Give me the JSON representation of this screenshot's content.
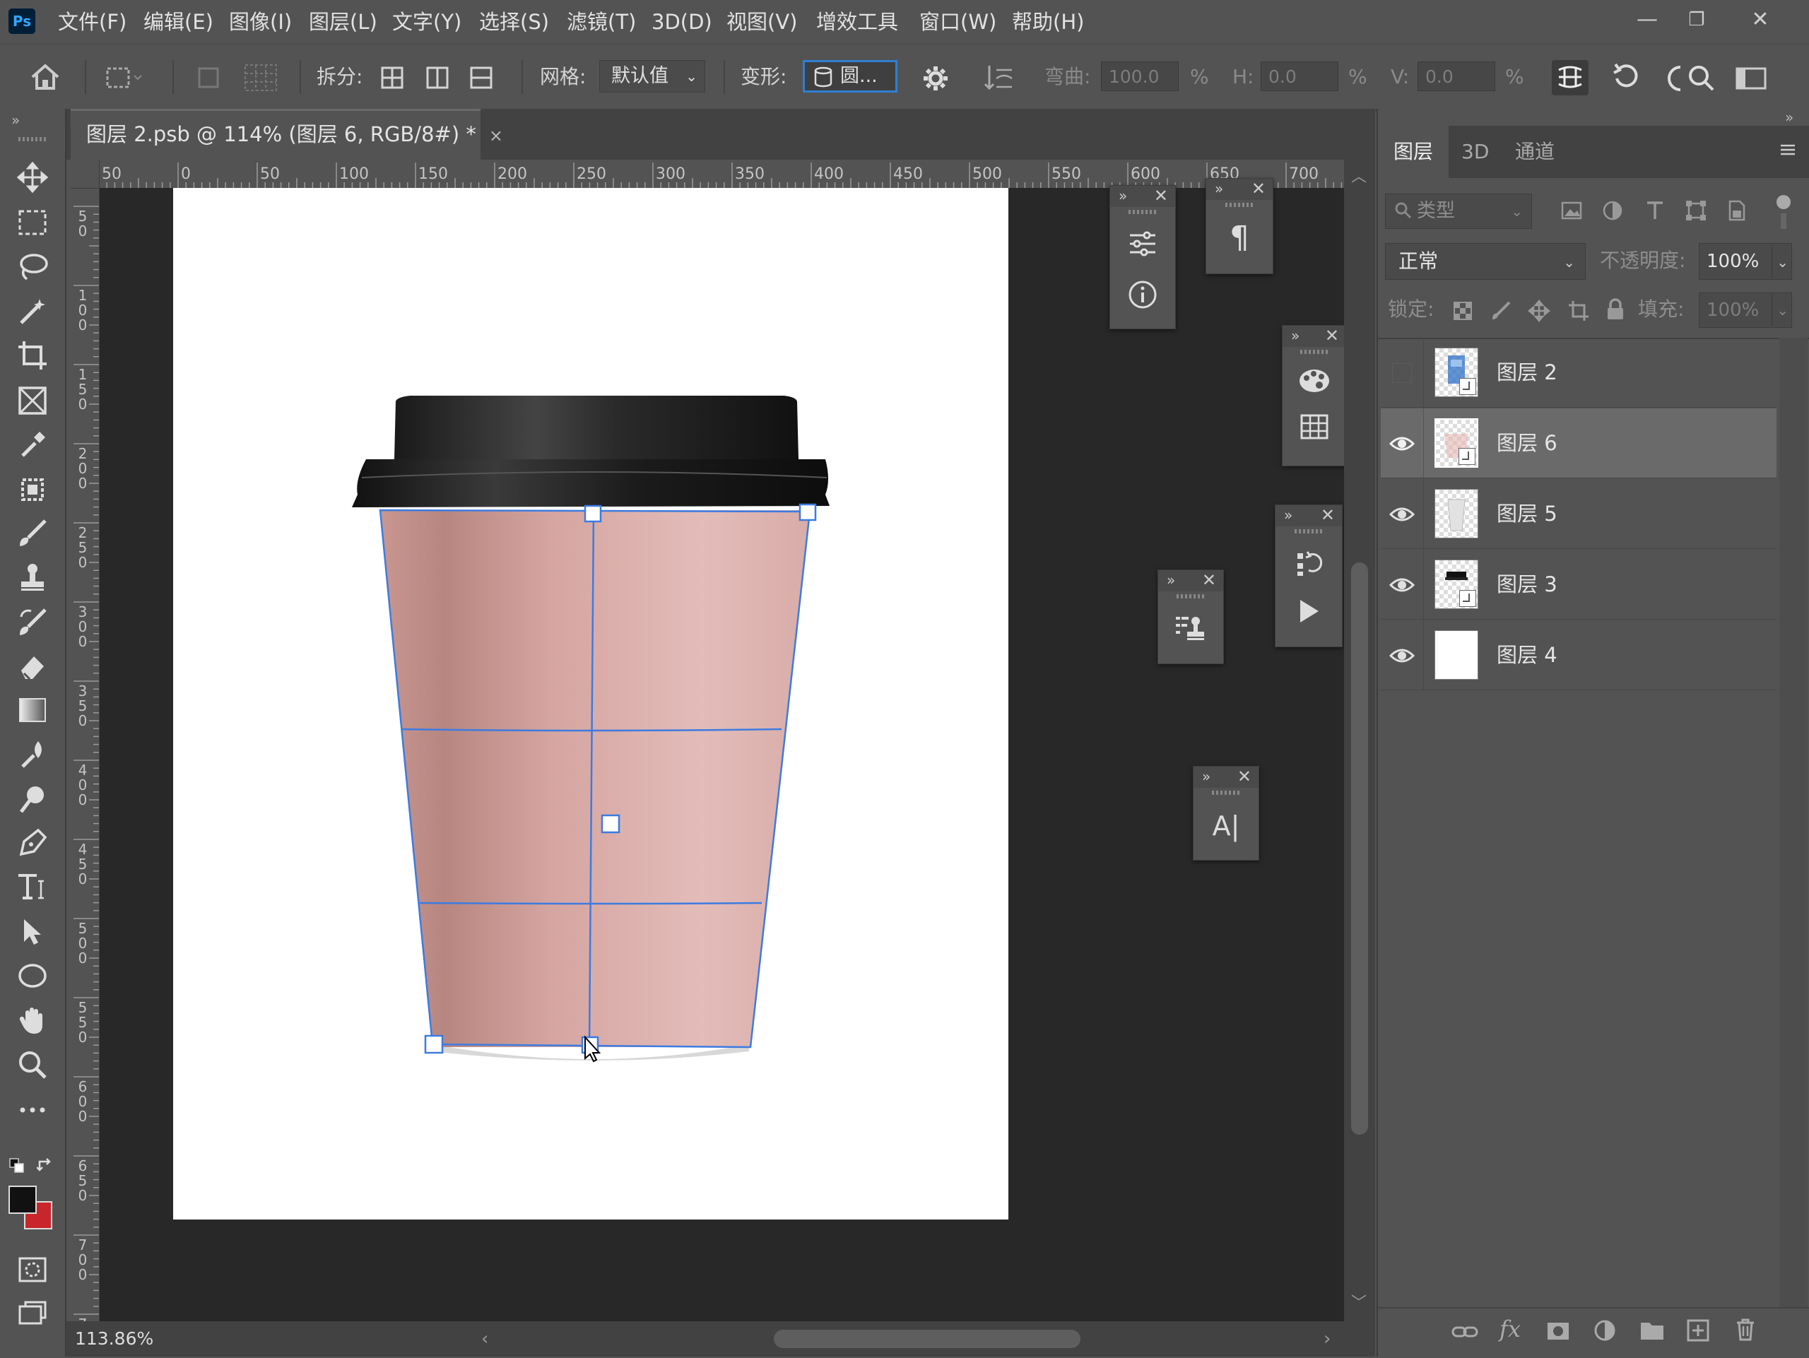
{
  "app": {
    "logo": "Ps"
  },
  "menu": [
    "文件(F)",
    "编辑(E)",
    "图像(I)",
    "图层(L)",
    "文字(Y)",
    "选择(S)",
    "滤镜(T)",
    "3D(D)",
    "视图(V)",
    "增效工具",
    "窗口(W)",
    "帮助(H)"
  ],
  "window_controls": {
    "minimize": "—",
    "maximize": "❐",
    "close": "✕"
  },
  "options": {
    "split_label": "拆分:",
    "grid_label": "网格:",
    "grid_value": "默认值",
    "warp_label": "变形:",
    "warp_value": "圆...",
    "bend_label": "弯曲:",
    "bend_value": "100.0",
    "h_label": "H:",
    "h_value": "0.0",
    "v_label": "V:",
    "v_value": "0.0",
    "percent": "%"
  },
  "document": {
    "tab_title": "图层 2.psb @ 114% (图层 6, RGB/8#) *",
    "close": "×",
    "zoom": "113.86%"
  },
  "ruler": {
    "h_labels": [
      "50",
      "0",
      "50",
      "100",
      "150",
      "200",
      "250",
      "300",
      "350",
      "400",
      "450",
      "500",
      "550",
      "600",
      "650",
      "700"
    ],
    "v_labels": [
      "50",
      "100",
      "150",
      "200",
      "250",
      "300",
      "350",
      "400",
      "450",
      "500",
      "550",
      "600",
      "650",
      "700",
      "7"
    ]
  },
  "panels": {
    "tabs": [
      "图层",
      "3D",
      "通道"
    ],
    "filter_kind": "类型",
    "blend_mode": "正常",
    "opacity_label": "不透明度:",
    "opacity_value": "100%",
    "lock_label": "锁定:",
    "fill_label": "填充:",
    "fill_value": "100%",
    "mini_text_icon": "A|",
    "mini_para_icon": "¶"
  },
  "layers": [
    {
      "name": "图层 2",
      "visible": false,
      "selected": false
    },
    {
      "name": "图层 6",
      "visible": true,
      "selected": true
    },
    {
      "name": "图层 5",
      "visible": true,
      "selected": false
    },
    {
      "name": "图层 3",
      "visible": true,
      "selected": false
    },
    {
      "name": "图层 4",
      "visible": true,
      "selected": false
    }
  ],
  "colors": {
    "foreground": "#111111",
    "background": "#c8262b",
    "cup_sleeve": "#d9a6a2",
    "warp_grid": "#3d7be0"
  }
}
